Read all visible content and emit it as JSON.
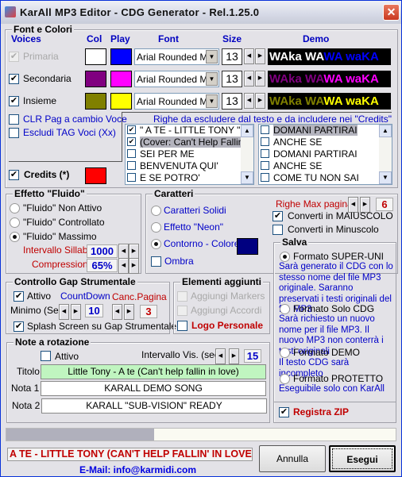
{
  "window": {
    "title": "KarAll MP3 Editor - CDG Generator - Rel.1.25.0",
    "close": "✕"
  },
  "fonts": {
    "legend": "Font e Colori",
    "headers": {
      "voices": "Voices",
      "col": "Col",
      "play": "Play",
      "font": "Font",
      "size": "Size",
      "demo": "Demo"
    },
    "rows": [
      {
        "label": "Primaria",
        "checked": true,
        "disabled": true,
        "col": "#ffffff",
        "play": "#0000ff",
        "font": "Arial Rounded MT",
        "size": "13",
        "demo_a": "WAka WA",
        "demo_b": "WA waKA"
      },
      {
        "label": "Secondaria",
        "checked": true,
        "disabled": false,
        "col": "#800080",
        "play": "#ff00ff",
        "font": "Arial Rounded MT",
        "size": "13",
        "demo_a": "WAka WA",
        "demo_b": "WA waKA"
      },
      {
        "label": "Insieme",
        "checked": true,
        "disabled": false,
        "col": "#808000",
        "play": "#ffff00",
        "font": "Arial Rounded MT",
        "size": "13",
        "demo_a": "WAka WA",
        "demo_b": "WA waKA"
      }
    ],
    "clr": "CLR Pag a cambio Voce",
    "escludi": "Escludi TAG Voci (Xx)",
    "credits": "Credits (*)",
    "credits_color": "#ff0000",
    "righe_label": "Righe da escludere dal testo e da includere nei \"Credits\"",
    "list1": [
      {
        "text": "\" A TE - LITTLE TONY \"",
        "checked": true
      },
      {
        "text": "(Cover: Can't Help Fallin in",
        "checked": true,
        "selected": true
      },
      {
        "text": "SEI PER ME",
        "checked": false
      },
      {
        "text": "BENVENUTA QUI'",
        "checked": false
      },
      {
        "text": "E SE POTRO'",
        "checked": false
      }
    ],
    "list2": [
      {
        "text": "DOMANI PARTIRAI",
        "checked": false,
        "selected": true
      },
      {
        "text": "ANCHE SE",
        "checked": false
      },
      {
        "text": "DOMANI PARTIRAI",
        "checked": false
      },
      {
        "text": "ANCHE SE",
        "checked": false
      },
      {
        "text": "COME TU NON SAI",
        "checked": false
      }
    ]
  },
  "fluido": {
    "legend": "Effetto \"Fluido\"",
    "options": [
      "\"Fluido\" Non Attivo",
      "\"Fluido\" Controllato",
      "\"Fluido\" Massimo"
    ],
    "selected": 2,
    "intervallo_label": "Intervallo Sillabe",
    "intervallo": "1000",
    "compressione_label": "Compressione",
    "compressione": "65%"
  },
  "caratteri": {
    "legend": "Caratteri",
    "options": [
      "Caratteri Solidi",
      "Effetto \"Neon\"",
      "Contorno - Colore"
    ],
    "selected": 2,
    "contorno_color": "#000080",
    "ombra": "Ombra",
    "righe_max_label": "Righe Max pagina",
    "righe_max": "6",
    "maiuscolo": "Converti in MAIUSCOLO",
    "minuscolo": "Converti in Minuscolo"
  },
  "gap": {
    "legend": "Controllo Gap Strumentale",
    "attivo": "Attivo",
    "countdown": "CountDown",
    "canc": "Canc.Pagina",
    "minimo": "Minimo (Sec)",
    "minimo_val": "10",
    "canc_val": "3",
    "splash": "Splash Screen su Gap Strumentale"
  },
  "elementi": {
    "legend": "Elementi aggiunti",
    "markers": "Aggiungi Markers",
    "accordi": "Aggiungi Accordi",
    "logo": "Logo Personale"
  },
  "salva": {
    "legend": "Salva",
    "selected": 0,
    "options": [
      {
        "label": "Formato SUPER-UNI",
        "desc": "Sarà generato il CDG con lo stesso nome del file MP3 originale. Saranno preservati i testi originali del file MP3"
      },
      {
        "label": "Formato Solo CDG",
        "desc": "Sarà richiesto un nuovo nome per il file MP3. Il nuovo MP3 non conterrà i testi originali"
      },
      {
        "label": "Formato DEMO",
        "desc": "Il testo CDG sarà incompleto"
      },
      {
        "label": "Formato PROTETTO",
        "desc": "Eseguibile solo con KarAll"
      }
    ],
    "zip": "Registra ZIP"
  },
  "note": {
    "legend": "Note a rotazione",
    "attivo": "Attivo",
    "intervallo_label": "Intervallo Vis. (sec.)",
    "intervallo": "15",
    "titolo_label": "Titolo",
    "titolo": "Little Tony - A te (Can't help fallin in love)",
    "nota1_label": "Nota 1",
    "nota1": "KARALL DEMO SONG",
    "nota2_label": "Nota 2",
    "nota2": "KARALL \"SUB-VISION\" READY"
  },
  "progress": 0.38,
  "status": "A TE - LITTLE TONY (CAN'T HELP FALLIN' IN LOVE",
  "email": "E-Mail: info@karmidi.com",
  "buttons": {
    "annulla": "Annulla",
    "esegui": "Esegui"
  }
}
